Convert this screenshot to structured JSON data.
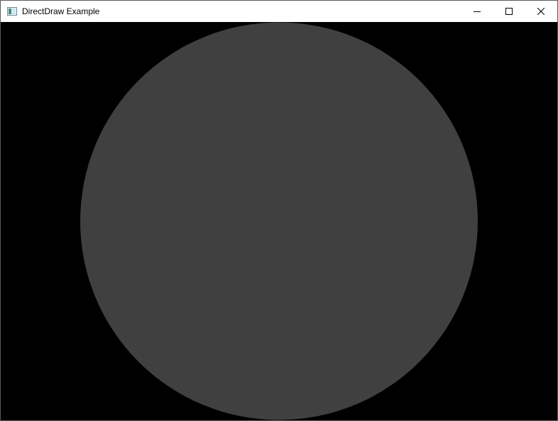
{
  "window": {
    "title": "DirectDraw Example",
    "icon": "application-window-icon",
    "controls": [
      "minimize-icon",
      "maximize-icon",
      "close-icon"
    ]
  },
  "canvas": {
    "background_color": "#000000",
    "shape": "circle",
    "fill_color": "#404040"
  }
}
